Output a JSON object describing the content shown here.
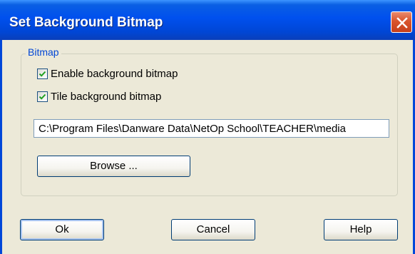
{
  "window": {
    "title": "Set Background Bitmap",
    "close_icon": "close-icon"
  },
  "group": {
    "legend": "Bitmap"
  },
  "options": {
    "enable_label": "Enable background bitmap",
    "enable_checked": true,
    "tile_label": "Tile background bitmap",
    "tile_checked": true
  },
  "path_field": {
    "value": "C:\\Program Files\\Danware Data\\NetOp School\\TEACHER\\media"
  },
  "buttons": {
    "browse_label": "Browse ...",
    "ok_label": "Ok",
    "cancel_label": "Cancel",
    "help_label": "Help"
  },
  "colors": {
    "titlebar": "#0050ee",
    "client_background": "#ece9d8",
    "legend_text": "#0046d5",
    "close_button": "#d9542c",
    "check_mark": "#21a121"
  }
}
